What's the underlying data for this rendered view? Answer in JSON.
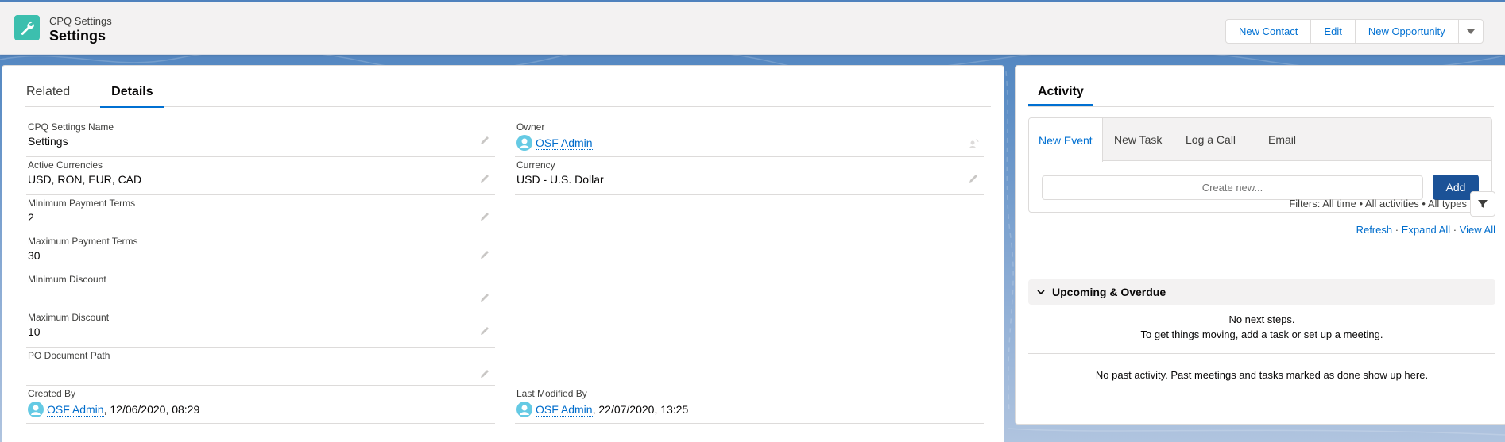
{
  "header": {
    "object_type": "CPQ Settings",
    "record_title": "Settings",
    "icon": "wrench-icon",
    "actions": [
      "New Contact",
      "Edit",
      "New Opportunity"
    ],
    "more_actions_icon": "chevron-down-icon"
  },
  "detail_tabs": [
    {
      "label": "Related",
      "active": false
    },
    {
      "label": "Details",
      "active": true
    }
  ],
  "fields_left": [
    {
      "label": "CPQ Settings Name",
      "value": "Settings"
    },
    {
      "label": "Active Currencies",
      "value": "USD, RON, EUR, CAD"
    },
    {
      "label": "Minimum Payment Terms",
      "value": "2"
    },
    {
      "label": "Maximum Payment Terms",
      "value": "30"
    },
    {
      "label": "Minimum Discount",
      "value": ""
    },
    {
      "label": "Maximum Discount",
      "value": "10"
    },
    {
      "label": "PO Document Path",
      "value": ""
    }
  ],
  "fields_right": [
    {
      "label": "Owner",
      "link": "OSF Admin"
    },
    {
      "label": "Currency",
      "value": "USD - U.S. Dollar"
    }
  ],
  "system_fields": {
    "created_by": {
      "label": "Created By",
      "link": "OSF Admin",
      "suffix": ", 12/06/2020, 08:29"
    },
    "last_modified_by": {
      "label": "Last Modified By",
      "link": "OSF Admin",
      "suffix": ", 22/07/2020, 13:25"
    }
  },
  "activity": {
    "tab_label": "Activity",
    "composer_tabs": [
      "New Event",
      "New Task",
      "Log a Call",
      "Email"
    ],
    "active_composer_tab": "New Event",
    "create_placeholder": "Create new...",
    "add_label": "Add",
    "filters_text": "Filters: All time • All activities • All types",
    "links": [
      "Refresh",
      "Expand All",
      "View All"
    ],
    "upcoming_header": "Upcoming & Overdue",
    "no_next_steps": "No next steps.",
    "no_next_steps_hint": "To get things moving, add a task or set up a meeting.",
    "no_past_activity": "No past activity. Past meetings and tasks marked as done show up here."
  },
  "colors": {
    "brand_blue": "#0070d2",
    "link_blue": "#006dcc",
    "add_button": "#1b5297",
    "object_icon": "#3cbfae",
    "avatar": "#65cae4"
  }
}
